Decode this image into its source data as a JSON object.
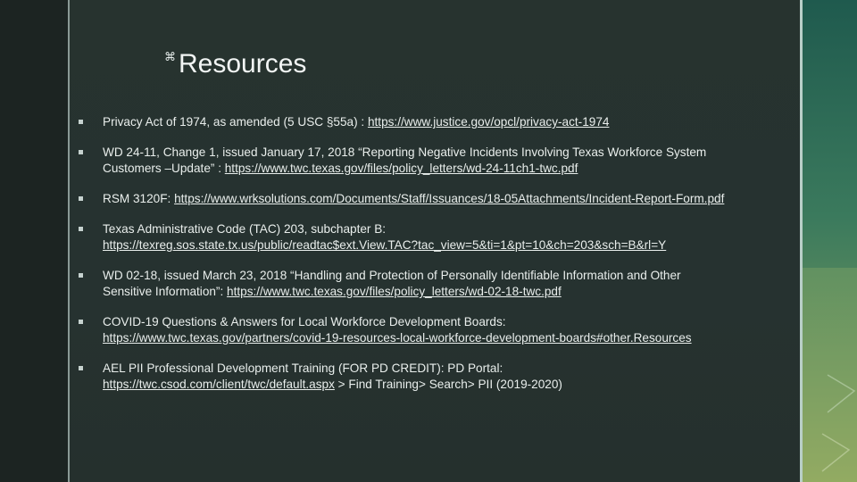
{
  "title": "Resources",
  "title_icon": "z-icon",
  "colors": {
    "background": "#263230",
    "text": "#e9eeec",
    "accent_band": "#3b7a5d"
  },
  "resources": [
    {
      "lines": [
        {
          "text": "Privacy Act of 1974, as amended (5 USC §55a) :  ",
          "link": "https://www.justice.gov/opcl/privacy-act-1974",
          "after": ""
        }
      ]
    },
    {
      "lines": [
        {
          "text": "WD 24-11, Change 1, issued January 17, 2018 “Reporting Negative Incidents Involving Texas Workforce System",
          "link": "",
          "after": ""
        },
        {
          "text": "Customers –Update” :  ",
          "link": "https://www.twc.texas.gov/files/policy_letters/wd-24-11ch1-twc.pdf",
          "after": ""
        }
      ]
    },
    {
      "lines": [
        {
          "text": "RSM 3120F:  ",
          "link": "https://www.wrksolutions.com/Documents/Staff/Issuances/18-05Attachments/Incident-Report-Form.pdf",
          "after": ""
        }
      ]
    },
    {
      "lines": [
        {
          "text": "Texas Administrative Code (TAC) 203, subchapter B:",
          "link": "",
          "after": ""
        },
        {
          "text": "",
          "link": "https://texreg.sos.state.tx.us/public/readtac$ext.View.TAC?tac_view=5&ti=1&pt=10&ch=203&sch=B&rl=Y",
          "after": ""
        }
      ]
    },
    {
      "lines": [
        {
          "text": "WD 02-18, issued March 23, 2018 “Handling and Protection of Personally Identifiable Information and Other",
          "link": "",
          "after": ""
        },
        {
          "text": "Sensitive Information”: ",
          "link": "https://www.twc.texas.gov/files/policy_letters/wd-02-18-twc.pdf",
          "after": ""
        }
      ]
    },
    {
      "lines": [
        {
          "text": "COVID-19 Questions & Answers for Local Workforce Development Boards:",
          "link": "",
          "after": ""
        },
        {
          "text": "",
          "link": "https://www.twc.texas.gov/partners/covid-19-resources-local-workforce-development-boards#other.Resources",
          "after": ""
        }
      ]
    },
    {
      "lines": [
        {
          "text": "AEL PII Professional Development Training (FOR PD CREDIT):  PD Portal:",
          "link": "",
          "after": ""
        },
        {
          "text": "",
          "link": "https://twc.csod.com/client/twc/default.aspx",
          "after": "  > Find Training> Search> PII (2019-2020)"
        }
      ]
    }
  ]
}
